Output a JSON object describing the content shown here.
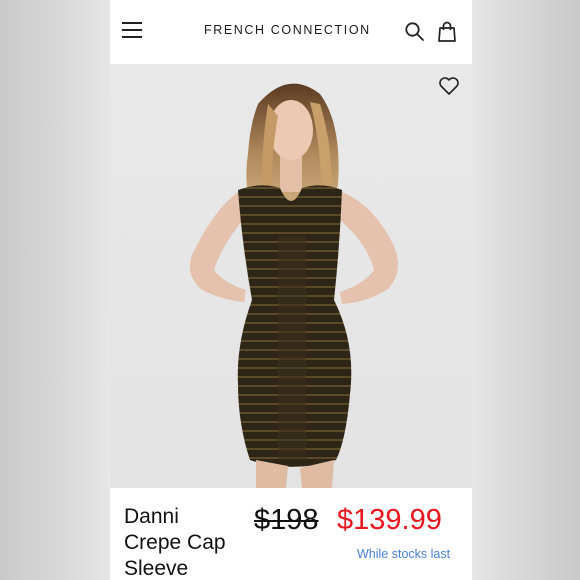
{
  "header": {
    "brand": "FRENCH CONNECTION",
    "icons": [
      "menu-icon",
      "search-icon",
      "shopping-bag-icon"
    ]
  },
  "product": {
    "image_icon": "wishlist-heart-icon",
    "title_lines": [
      "Danni",
      "Crepe Cap",
      "Sleeve"
    ],
    "price_original": "$198",
    "price_sale": "$139.99",
    "stock_note": "While stocks last"
  },
  "colors": {
    "sale_price": "#e8161e",
    "stock_note": "#4a7fd4",
    "text": "#111111"
  }
}
